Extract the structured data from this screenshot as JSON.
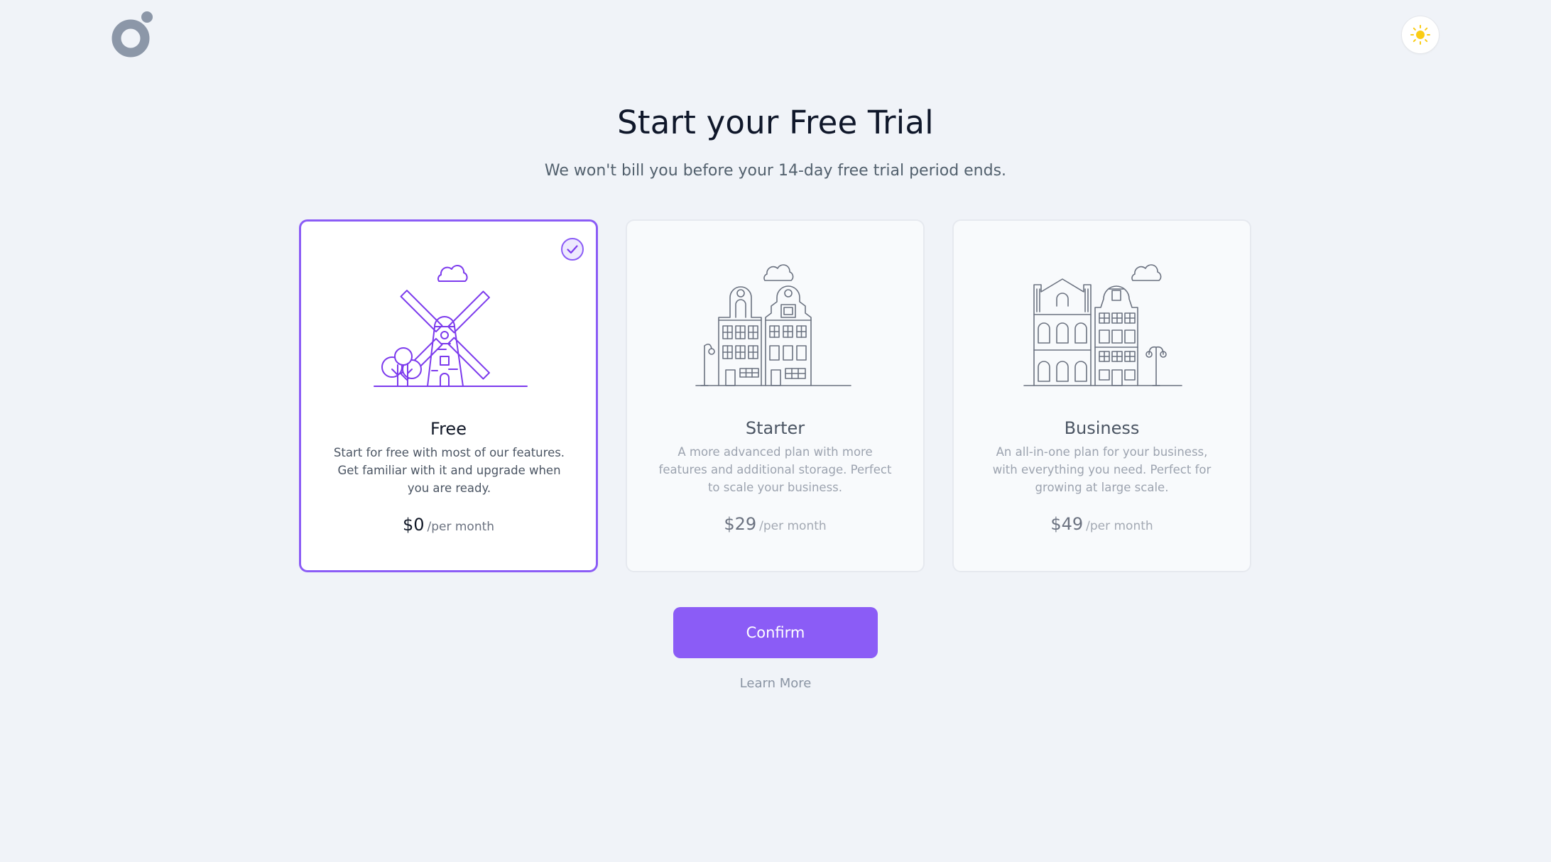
{
  "header": {
    "logo_icon": "brand-logo-icon",
    "theme_toggle_icon": "sun-icon"
  },
  "hero": {
    "title": "Start your Free Trial",
    "subtitle": "We won't bill you before your 14-day free trial period ends."
  },
  "plans": [
    {
      "name": "Free",
      "description": "Start for free with most of our features. Get familiar with it and upgrade when you are ready.",
      "price": "$0",
      "period": "/per month",
      "selected": true,
      "illustration": "windmill-illustration"
    },
    {
      "name": "Starter",
      "description": "A more advanced plan with more features and additional storage. Perfect to scale your business.",
      "price": "$29",
      "period": "/per month",
      "selected": false,
      "illustration": "two-houses-illustration"
    },
    {
      "name": "Business",
      "description": "An all-in-one plan for your business, with everything you need. Perfect for growing at large scale.",
      "price": "$49",
      "period": "/per month",
      "selected": false,
      "illustration": "city-buildings-illustration"
    }
  ],
  "actions": {
    "confirm_label": "Confirm",
    "learn_more_label": "Learn More"
  },
  "colors": {
    "accent": "#8b5cf6",
    "background": "#f0f3f8",
    "sun": "#facc15",
    "logo": "#8c97a8"
  }
}
